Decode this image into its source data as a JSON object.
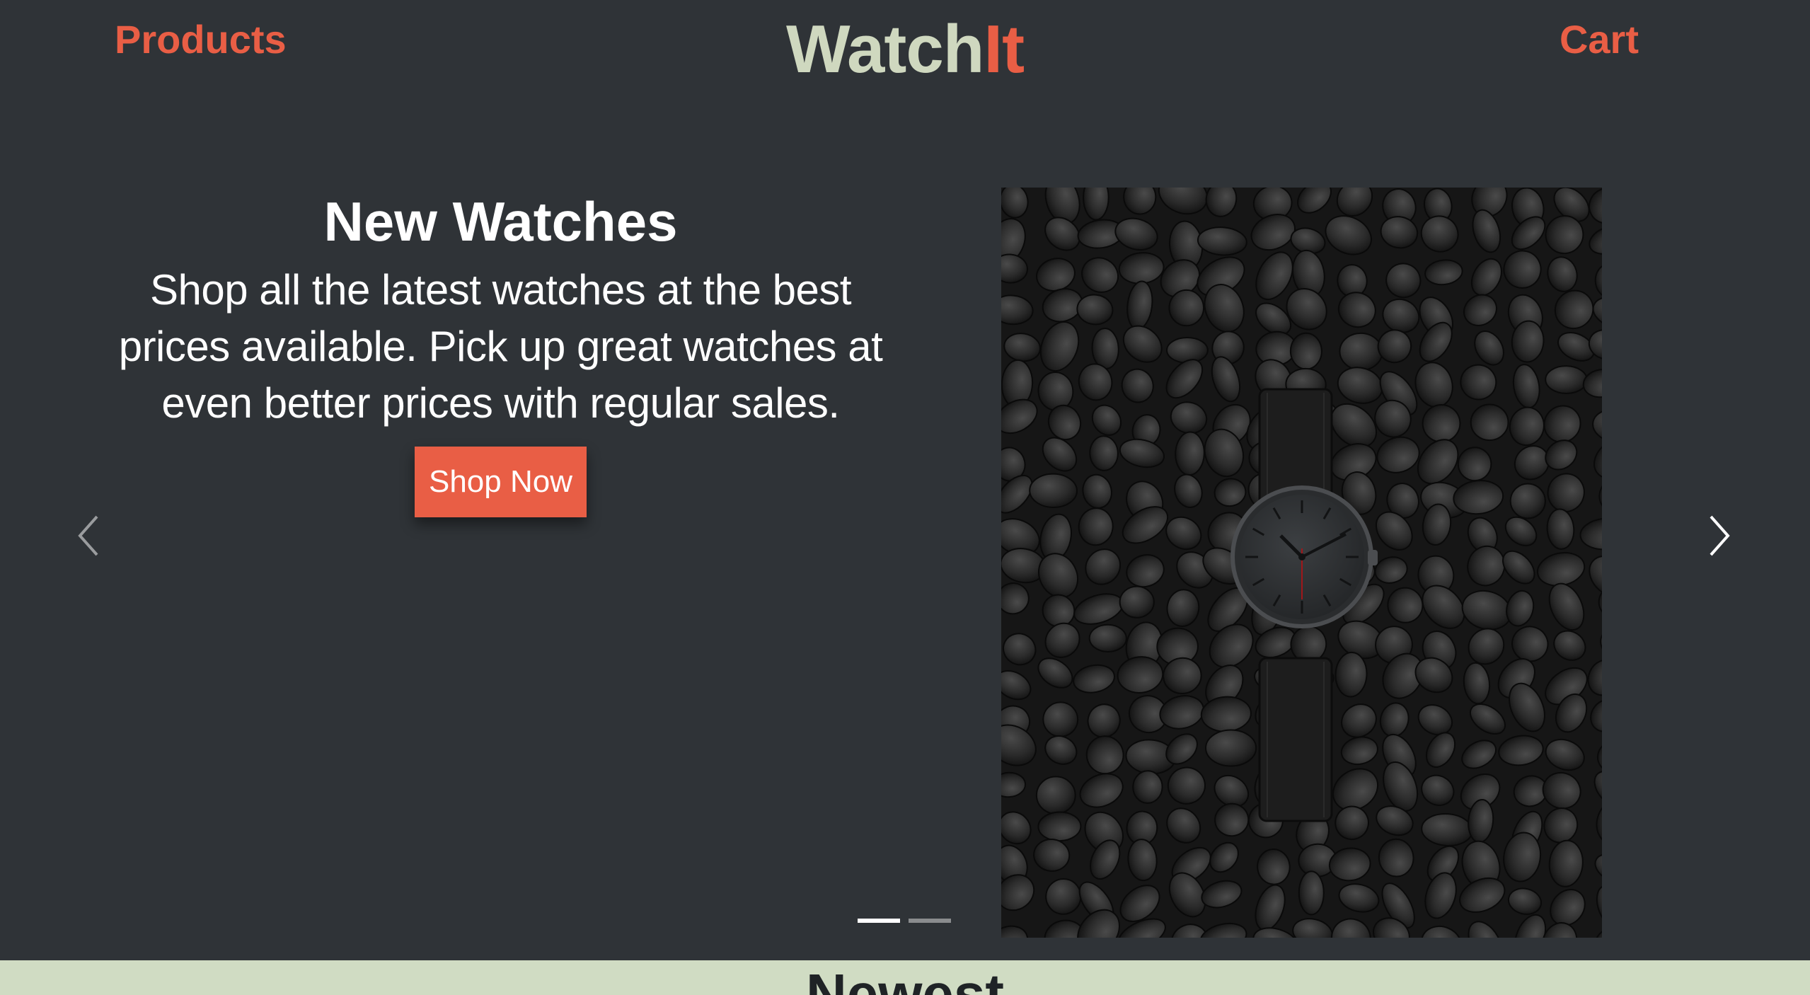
{
  "header": {
    "products_label": "Products",
    "logo_part1": "Watch",
    "logo_part2": "It",
    "cart_label": "Cart"
  },
  "hero": {
    "title": "New Watches",
    "description": "Shop all the latest watches at the best prices available. Pick up great watches at even better prices with regular sales.",
    "button_label": "Shop Now",
    "prev_icon": "chevron-left-icon",
    "next_icon": "chevron-right-icon",
    "slide_count": 2,
    "active_slide": 1
  },
  "section": {
    "newest_title": "Newest"
  },
  "colors": {
    "background": "#2f3337",
    "accent": "#e95e45",
    "logo_light": "#cfd8bf",
    "band": "#d0dcc3",
    "text": "#ffffff"
  }
}
